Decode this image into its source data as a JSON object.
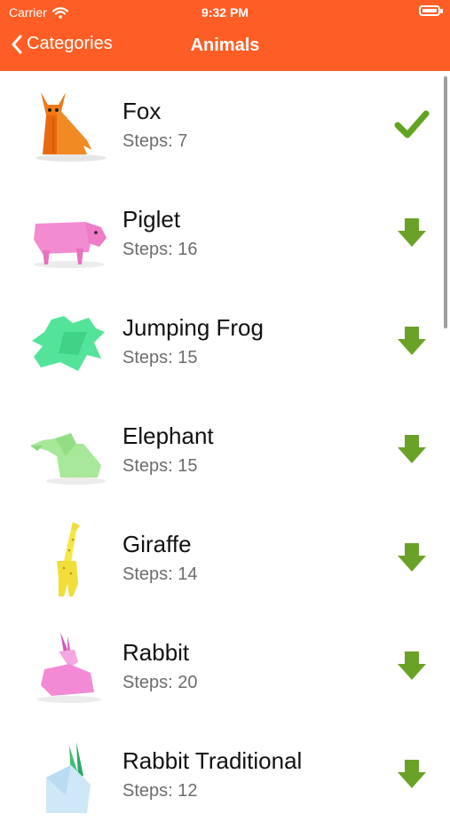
{
  "status_bar": {
    "carrier": "Carrier",
    "time": "9:32 PM"
  },
  "nav": {
    "back_label": "Categories",
    "title": "Animals"
  },
  "colors": {
    "accent": "#fe5e25",
    "download": "#6aa228",
    "done": "#62a421"
  },
  "items": [
    {
      "name": "Fox",
      "steps": "Steps: 7",
      "status": "done",
      "icon": "fox-origami-icon"
    },
    {
      "name": "Piglet",
      "steps": "Steps: 16",
      "status": "download",
      "icon": "piglet-origami-icon"
    },
    {
      "name": "Jumping Frog",
      "steps": "Steps: 15",
      "status": "download",
      "icon": "frog-origami-icon"
    },
    {
      "name": "Elephant",
      "steps": "Steps: 15",
      "status": "download",
      "icon": "elephant-origami-icon"
    },
    {
      "name": "Giraffe",
      "steps": "Steps: 14",
      "status": "download",
      "icon": "giraffe-origami-icon"
    },
    {
      "name": "Rabbit",
      "steps": "Steps: 20",
      "status": "download",
      "icon": "rabbit-origami-icon"
    },
    {
      "name": "Rabbit Traditional",
      "steps": "Steps: 12",
      "status": "download",
      "icon": "rabbit-traditional-origami-icon"
    }
  ]
}
